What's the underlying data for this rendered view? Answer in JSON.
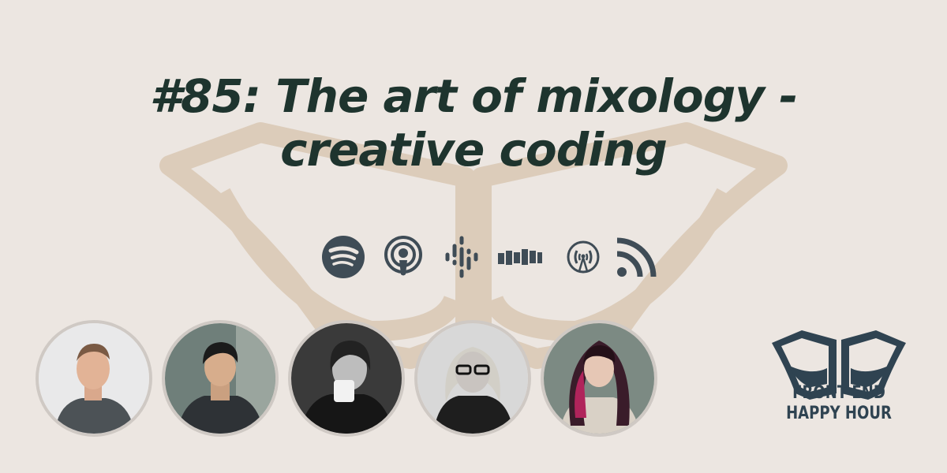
{
  "episode": {
    "title": "#85: The art of mixology - creative coding"
  },
  "platforms": [
    {
      "icon": "spotify-icon"
    },
    {
      "icon": "apple-podcasts-icon"
    },
    {
      "icon": "google-podcasts-icon"
    },
    {
      "icon": "stitcher-icon"
    },
    {
      "icon": "overcast-icon"
    },
    {
      "icon": "rss-icon"
    }
  ],
  "hosts": [
    {
      "id": "host-1"
    },
    {
      "id": "host-2"
    },
    {
      "id": "host-3"
    },
    {
      "id": "host-4"
    },
    {
      "id": "host-5"
    }
  ],
  "brand": {
    "line1": "FRONT END",
    "line2": "HAPPY HOUR"
  },
  "colors": {
    "background": "#ece6e1",
    "title": "#1e342e",
    "icons": "#3f4c56",
    "brand": "#2f4351",
    "watermark": "#dccbb8"
  }
}
